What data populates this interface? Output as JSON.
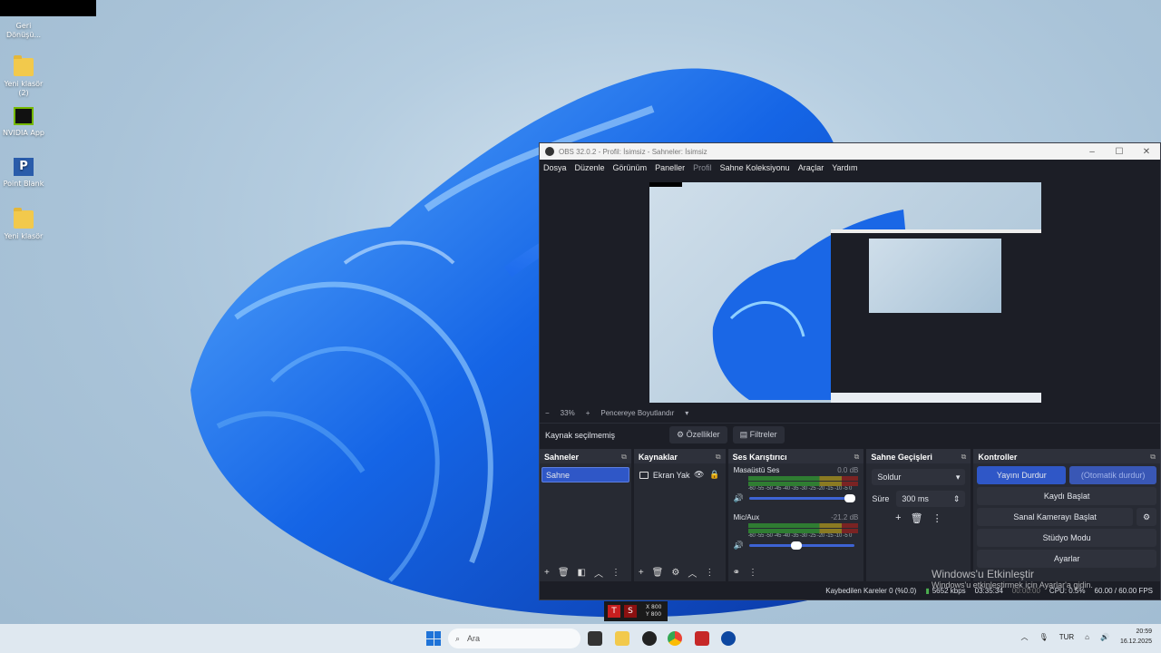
{
  "desktop": {
    "icons": [
      {
        "label": "Geri Dönüşü...",
        "icon": "recycle-bin-icon"
      },
      {
        "label": "Yeni klasör (2)",
        "icon": "folder-icon"
      },
      {
        "label": "NVIDIA App",
        "icon": "nvidia-icon"
      },
      {
        "label": "Point Blank",
        "icon": "point-blank-icon"
      },
      {
        "label": "Yeni klasör",
        "icon": "folder-icon"
      }
    ]
  },
  "obs": {
    "title": "OBS 32.0.2 - Profil: İsimsiz - Sahneler: İsimsiz",
    "menu": [
      "Dosya",
      "Düzenle",
      "Görünüm",
      "Paneller",
      "Profil",
      "Sahne Koleksiyonu",
      "Araçlar",
      "Yardım"
    ],
    "zoom": {
      "minus": "−",
      "value": "33%",
      "plus": "+",
      "mode": "Pencereye Boyutlandır"
    },
    "source_bar": {
      "label": "Kaynak seçilmemiş",
      "properties": "Özellikler",
      "filters": "Filtreler"
    },
    "scenes": {
      "title": "Sahneler",
      "items": [
        "Sahne"
      ]
    },
    "sources": {
      "title": "Kaynaklar",
      "items": [
        "Ekran Yak"
      ]
    },
    "mixer": {
      "title": "Ses Karıştırıcı",
      "channels": [
        {
          "name": "Masaüstü Ses",
          "db": "0.0 dB",
          "level": 0.95
        },
        {
          "name": "Mic/Aux",
          "db": "-21.2 dB",
          "level": 0.45
        }
      ],
      "scale": "-60 -55 -50 -45 -40 -35 -30 -25 -20 -15 -10 -5 0"
    },
    "transitions": {
      "title": "Sahne Geçişleri",
      "type": "Soldur",
      "duration_label": "Süre",
      "duration": "300 ms"
    },
    "controls": {
      "title": "Kontroller",
      "stop_stream": "Yayını Durdur",
      "auto_stop": "(Otomatik durdur)",
      "record": "Kaydı Başlat",
      "virtual_cam": "Sanal Kamerayı Başlat",
      "studio": "Stüdyo Modu",
      "settings": "Ayarlar"
    },
    "status": {
      "dropped": "Kaybedilen Kareler 0 (%0.0)",
      "bitrate": "5652 kbps",
      "time": "03:35:34",
      "rec_time": "00:00:00",
      "cpu": "CPU: 0.5%",
      "fps": "60.00 / 60.00 FPS"
    }
  },
  "watermark": {
    "title": "Windows'u Etkinleştir",
    "sub": "Windows'u etkinleştirmek için Ayarlar'a gidin."
  },
  "rec_overlay": {
    "x": "X 800",
    "y": "Y 800"
  },
  "taskbar": {
    "search": "Ara",
    "lang": "TUR",
    "time": "20:59",
    "date": "16.12.2025"
  }
}
